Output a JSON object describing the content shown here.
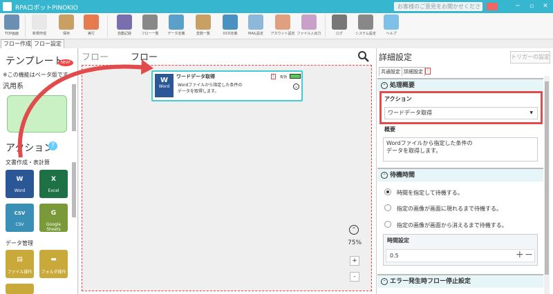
{
  "window": {
    "title": "RPAロボットPINOKIO",
    "feedback_placeholder": "お客様のご意見をお聞かせください",
    "min": "─",
    "max": "▫",
    "close": "✕"
  },
  "ribbon": [
    {
      "label": "TOP画面",
      "color": "#6a8fb3"
    },
    {
      "label": "新規作成",
      "color": "#e8e8e8"
    },
    {
      "label": "保存",
      "color": "#c9a064"
    },
    {
      "label": "実行",
      "color": "#e57b4f"
    },
    {
      "label": "自動記録",
      "color": "#7a6fae"
    },
    {
      "label": "フロー一覧",
      "color": "#888"
    },
    {
      "label": "データ定義",
      "color": "#5aa0c8"
    },
    {
      "label": "変数一覧",
      "color": "#c9a064"
    },
    {
      "label": "OCR定義",
      "color": "#4a90c0"
    },
    {
      "label": "MAIL設定",
      "color": "#8fb8d8"
    },
    {
      "label": "アカウント設定",
      "color": "#e0a080"
    },
    {
      "label": "ファイル入出力",
      "color": "#c9a0c8"
    },
    {
      "label": "ログ",
      "color": "#777"
    },
    {
      "label": "システム設定",
      "color": "#888"
    },
    {
      "label": "ヘルプ",
      "color": "#7ec0e8"
    }
  ],
  "tabs": {
    "flow_create": "フロー作成",
    "flow_settings": "フロー設定"
  },
  "left": {
    "template_title": "テンプレート",
    "new_badge": "NEW!",
    "beta_note": "※この機能はベータ版です。",
    "general": "汎用系",
    "action_title": "アクション",
    "help": "?",
    "category_docs": "文書作成・表計算",
    "category_data": "データ管理",
    "tiles": [
      {
        "label": "Word",
        "glyph": "W",
        "color": "#2b5797"
      },
      {
        "label": "Excel",
        "glyph": "X",
        "color": "#1e7145"
      },
      {
        "label": "CSV",
        "glyph": "CSV",
        "color": "#3a8fb7"
      },
      {
        "label": "Google Sheets",
        "glyph": "G",
        "color": "#7a9a3a"
      },
      {
        "label": "ファイル操作",
        "glyph": "▤",
        "color": "#c9a93a"
      },
      {
        "label": "フォルダ操作",
        "glyph": "▬",
        "color": "#c9a93a"
      }
    ]
  },
  "canvas": {
    "title": "フロー",
    "zoom": "75%",
    "zoom_in": "+",
    "zoom_out": "-"
  },
  "block": {
    "icon_label": "Word",
    "title": "ワードデータ取得",
    "desc1": "Wordファイルから指定した条件の",
    "desc2": "データを取得します。",
    "warn": "!",
    "valid": "有効"
  },
  "right": {
    "title": "詳細設定",
    "trigger": "トリガーの設定",
    "tab_common": "共通設定",
    "tab_detail": "詳細設定",
    "tab_warn": "!",
    "overview_header": "処理概要",
    "action_label": "アクション",
    "action_value": "ワードデータ取得",
    "summary_label": "概要",
    "summary_line1": "Wordファイルから指定した条件の",
    "summary_line2": "データを取得します。",
    "wait_header": "待機時間",
    "radio1": "時間を指定して待機する。",
    "radio2": "指定の画像が画面に現れるまで待機する。",
    "radio3": "指定の画像が画面から消えるまで待機する。",
    "time_label": "時間設定",
    "time_value": "0.5",
    "plus": "+",
    "minus": "−",
    "error_header": "エラー発生時フロー停止設定"
  }
}
